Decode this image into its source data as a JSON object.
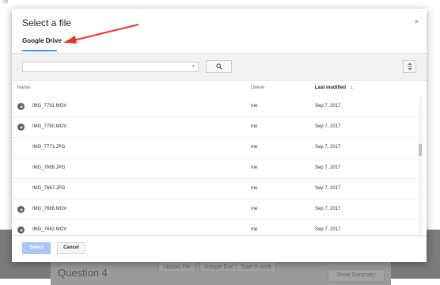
{
  "background": {
    "corner_text": "QR",
    "question": "Question 4",
    "buttons": [
      "Upload File",
      "Google Doc",
      "Type in work"
    ],
    "show_summary": "Show Summary"
  },
  "dialog": {
    "title": "Select a file",
    "close": "×",
    "tab": "Google Drive",
    "search": {
      "value": "",
      "placeholder": ""
    },
    "columns": {
      "name": "Name",
      "owner": "Owner",
      "last_modified": "Last modified",
      "sort_arrow": "↓"
    },
    "files": [
      {
        "name": "IMG_7791.MOV",
        "type": "video",
        "owner": "me",
        "modified": "Sep 7, 2017"
      },
      {
        "name": "IMG_7790.MOV",
        "type": "video",
        "owner": "me",
        "modified": "Sep 7, 2017"
      },
      {
        "name": "IMG_7771.JPG",
        "type": "image",
        "owner": "me",
        "modified": "Sep 7, 2017"
      },
      {
        "name": "IMG_7668.JPG",
        "type": "image",
        "owner": "me",
        "modified": "Sep 7, 2017"
      },
      {
        "name": "IMG_7667.JPG",
        "type": "image",
        "owner": "me",
        "modified": "Sep 7, 2017"
      },
      {
        "name": "IMG_7666.MOV",
        "type": "video",
        "owner": "me",
        "modified": "Sep 7, 2017"
      },
      {
        "name": "IMG_7662.MOV",
        "type": "video",
        "owner": "me",
        "modified": "Sep 7, 2017"
      }
    ],
    "footer": {
      "select": "Select",
      "cancel": "Cancel"
    }
  },
  "colors": {
    "accent": "#4d90fe",
    "select_button": "#a9c4f5",
    "annotation_arrow": "#e03a2e"
  }
}
